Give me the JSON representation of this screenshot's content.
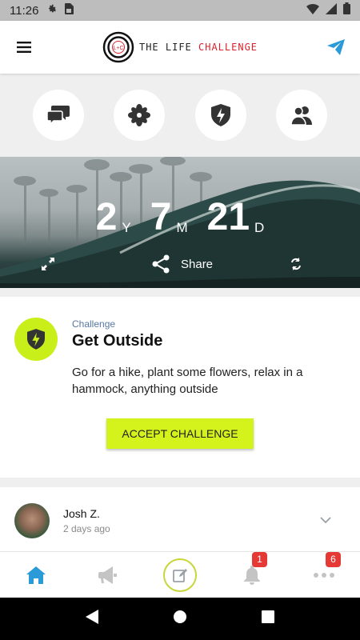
{
  "status_bar": {
    "time": "11:26",
    "icons_left": [
      "settings-icon",
      "sim-card-icon"
    ],
    "icons_right": [
      "wifi-icon",
      "signal-icon",
      "battery-icon"
    ]
  },
  "app_bar": {
    "logo_mark": "L+C",
    "logo_text_main": "THE LIFE ",
    "logo_text_accent": "CHALLENGE",
    "menu_icon": "hamburger-menu-icon",
    "send_icon": "paper-plane-icon"
  },
  "quick_actions": [
    {
      "name": "chat",
      "icon": "chat-bubbles-icon"
    },
    {
      "name": "pinwheel",
      "icon": "pinwheel-icon"
    },
    {
      "name": "challenge",
      "icon": "shield-bolt-icon"
    },
    {
      "name": "community",
      "icon": "people-icon"
    }
  ],
  "hero": {
    "years": "2",
    "years_unit": "Y",
    "months": "7",
    "months_unit": "M",
    "days": "21",
    "days_unit": "D",
    "share_label": "Share"
  },
  "challenge": {
    "kicker": "Challenge",
    "title": "Get Outside",
    "description": "Go for a hike, plant some flowers, relax in a hammock, anything outside",
    "accept_label": "ACCEPT CHALLENGE"
  },
  "post": {
    "author": "Josh Z.",
    "time": "2 days ago"
  },
  "tab_bar": {
    "home_icon": "home-icon",
    "announce_icon": "megaphone-icon",
    "compose_icon": "compose-icon",
    "notifications_badge": "1",
    "more_badge": "6"
  },
  "colors": {
    "accent_lime": "#c9ef1b",
    "button_lime": "#d4f21b",
    "brand_red": "#d9232e",
    "link_blue": "#2b9ad8",
    "badge_red": "#e53935"
  }
}
